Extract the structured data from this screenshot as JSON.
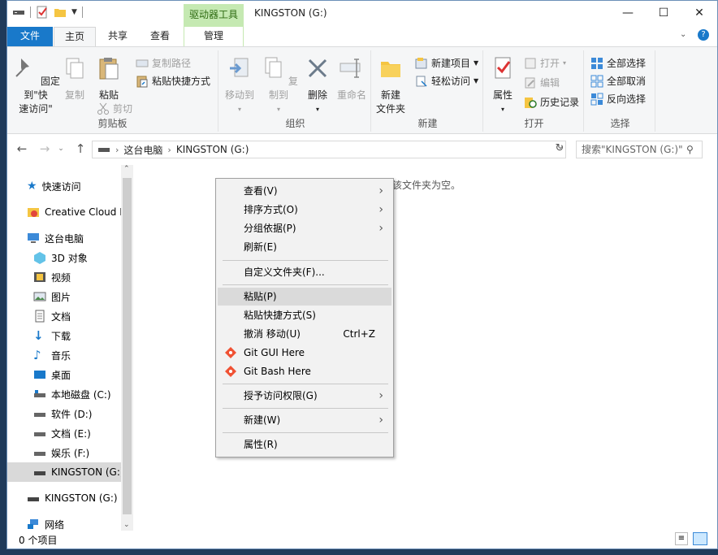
{
  "window": {
    "title": "KINGSTON (G:)",
    "contextual_tab_header": "驱动器工具"
  },
  "tabs": [
    {
      "label": "文件"
    },
    {
      "label": "主页"
    },
    {
      "label": "共享"
    },
    {
      "label": "查看"
    },
    {
      "label": "管理"
    }
  ],
  "ribbon": {
    "clipboard": {
      "label": "剪贴板",
      "pin": "固定到\"快\n速访问\"",
      "copy": "复制",
      "paste": "粘贴",
      "copy_path": "复制路径",
      "paste_shortcut": "粘贴快捷方式",
      "cut": "剪切"
    },
    "organize": {
      "label": "组织",
      "move_to": "移动到",
      "copy_to": "复制到",
      "delete": "删除",
      "rename": "重命名"
    },
    "new": {
      "label": "新建",
      "new_folder": "新建\n文件夹",
      "new_item": "新建项目",
      "easy_access": "轻松访问"
    },
    "open": {
      "label": "打开",
      "properties": "属性",
      "open": "打开",
      "edit": "编辑",
      "history": "历史记录"
    },
    "select": {
      "label": "选择",
      "select_all": "全部选择",
      "select_none": "全部取消",
      "invert": "反向选择"
    }
  },
  "address": {
    "crumbs": [
      "这台电脑",
      "KINGSTON (G:)"
    ],
    "search_placeholder": "搜索\"KINGSTON (G:)\""
  },
  "nav": {
    "items": [
      {
        "label": "快速访问",
        "icon": "star-icon"
      },
      {
        "label": "Creative Cloud Files",
        "icon": "creative-cloud-icon"
      },
      {
        "label": "这台电脑",
        "icon": "computer-icon"
      },
      {
        "label": "3D 对象",
        "icon": "cube-icon"
      },
      {
        "label": "视频",
        "icon": "video-icon"
      },
      {
        "label": "图片",
        "icon": "picture-icon"
      },
      {
        "label": "文档",
        "icon": "document-icon"
      },
      {
        "label": "下载",
        "icon": "download-icon"
      },
      {
        "label": "音乐",
        "icon": "music-icon"
      },
      {
        "label": "桌面",
        "icon": "desktop-icon"
      },
      {
        "label": "本地磁盘 (C:)",
        "icon": "drive-icon"
      },
      {
        "label": "软件 (D:)",
        "icon": "drive-icon"
      },
      {
        "label": "文档 (E:)",
        "icon": "drive-icon"
      },
      {
        "label": "娱乐 (F:)",
        "icon": "drive-icon"
      },
      {
        "label": "KINGSTON (G:)",
        "icon": "usb-drive-icon"
      },
      {
        "label": "KINGSTON (G:)",
        "icon": "usb-drive-icon"
      },
      {
        "label": "网络",
        "icon": "network-icon"
      }
    ]
  },
  "content": {
    "empty_message": "该文件夹为空。"
  },
  "status": {
    "item_count": "0 个项目"
  },
  "context_menu": {
    "items": [
      {
        "label": "查看(V)"
      },
      {
        "label": "排序方式(O)"
      },
      {
        "label": "分组依据(P)"
      },
      {
        "label": "刷新(E)"
      },
      {
        "label": "自定义文件夹(F)..."
      },
      {
        "label": "粘贴(P)"
      },
      {
        "label": "粘贴快捷方式(S)"
      },
      {
        "label": "撤消 移动(U)",
        "shortcut": "Ctrl+Z"
      },
      {
        "label": "Git GUI Here"
      },
      {
        "label": "Git Bash Here"
      },
      {
        "label": "授予访问权限(G)"
      },
      {
        "label": "新建(W)"
      },
      {
        "label": "属性(R)"
      }
    ]
  },
  "colors": {
    "file_tab": "#1979ca",
    "contextual_tab": "#c5e9b2",
    "selection": "#d9d9d9"
  }
}
